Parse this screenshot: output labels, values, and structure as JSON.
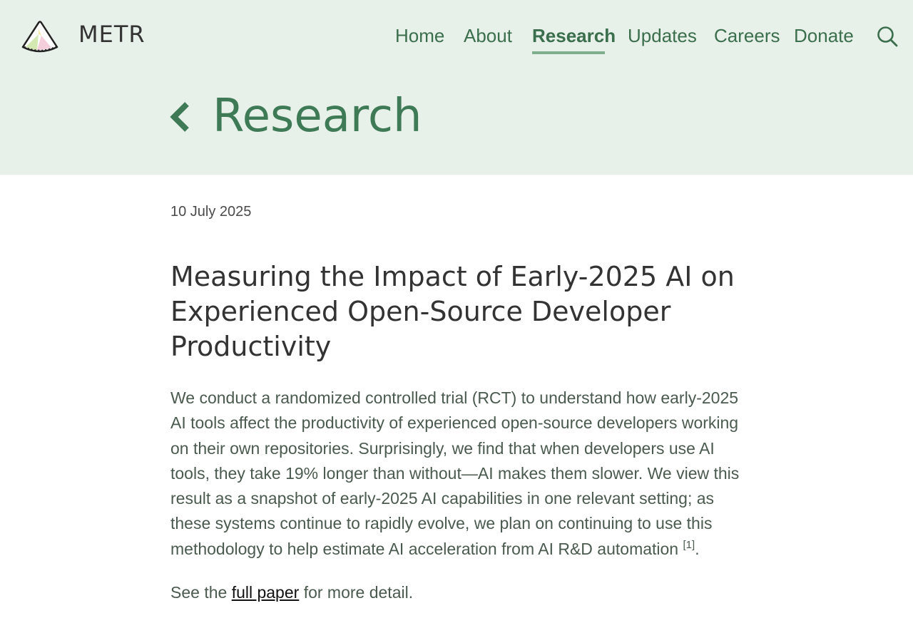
{
  "brand": {
    "name": "METR",
    "logo_icon": "metr-logo-icon"
  },
  "nav": {
    "items": [
      {
        "label": "Home",
        "active": false
      },
      {
        "label": "About",
        "active": false
      },
      {
        "label": "Research",
        "active": true
      },
      {
        "label": "Updates",
        "active": false
      },
      {
        "label": "Careers",
        "active": false
      },
      {
        "label": "Donate",
        "active": false
      }
    ],
    "search_icon": "search-icon"
  },
  "section": {
    "title": "Research",
    "back_icon": "chevron-left-icon"
  },
  "article": {
    "date": "10 July 2025",
    "title": "Measuring the Impact of Early-2025 AI on Experienced Open-Source Developer Productivity",
    "body": "We conduct a randomized controlled trial (RCT) to understand how early-2025 AI tools affect the productivity of experienced open-source developers working on their own repositories. Surprisingly, we find that when developers use AI tools, they take 19% longer than without—AI makes them slower. We view this result as a snapshot of early-2025 AI capabilities in one relevant setting; as these systems continue to rapidly evolve, we plan on continuing to use this methodology to help estimate AI acceleration from AI R&D automation",
    "footnote_ref": "[1]",
    "body_end": ".",
    "see_prefix": "See the",
    "see_link": "full paper",
    "see_suffix": "for more detail."
  },
  "colors": {
    "header_bg": "#e7f1e9",
    "accent_green": "#3e7a55",
    "nav_green": "#3b6e4c",
    "underline_green": "#7fae8d",
    "text_dark": "#333333",
    "body_text": "#4a5a4e"
  }
}
